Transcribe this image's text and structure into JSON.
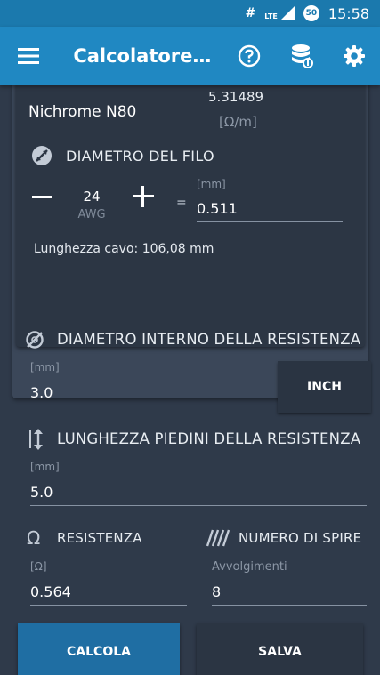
{
  "status_bar": {
    "icon_hash": "#",
    "network_label": "LTE",
    "notification_count": "50",
    "time": "15:58"
  },
  "app_bar": {
    "title": "Calcolatore r..."
  },
  "wire": {
    "material": "Nichrome N80",
    "resistivity_value": "5.31489",
    "resistivity_unit": "[Ω/m]",
    "diameter_title": "DIAMETRO DEL FILO",
    "gauge_value": "24",
    "gauge_unit": "AWG",
    "equals": "=",
    "mm_label": "[mm]",
    "mm_value": "0.511",
    "cable_length": "Lunghezza cavo: 106,08 mm"
  },
  "inner_diameter": {
    "title": "DIAMETRO INTERNO DELLA RESISTENZA",
    "unit_label": "[mm]",
    "value": "3.0",
    "unit_button": "INCH"
  },
  "leg_length": {
    "title": "LUNGHEZZA PIEDINI DELLA RESISTENZA",
    "unit_label": "[mm]",
    "value": "5.0"
  },
  "resistance": {
    "icon_glyph": "Ω",
    "title": "RESISTENZA",
    "unit_label": "[Ω]",
    "value": "0.564"
  },
  "turns": {
    "title": "NUMERO DI SPIRE",
    "sub_label": "Avvolgimenti",
    "value": "8"
  },
  "buttons": {
    "calculate": "CALCOLA",
    "save": "SALVA"
  },
  "colors": {
    "status_bar": "#1b79ad",
    "app_bar": "#2088c2",
    "background": "#2f3a4a",
    "card": "#2c3644",
    "panel": "#3b4759",
    "calculate_button": "#1f6ea3"
  },
  "icons": {
    "menu": "hamburger-menu-icon",
    "help": "help-circle-icon",
    "database": "database-icon",
    "settings": "gear-icon",
    "wire_diameter": "wire-diameter-icon",
    "inner_diameter": "coil-diameter-icon",
    "leg_length": "vertical-arrows-icon",
    "resistance": "omega-icon",
    "turns": "coil-turns-icon"
  }
}
